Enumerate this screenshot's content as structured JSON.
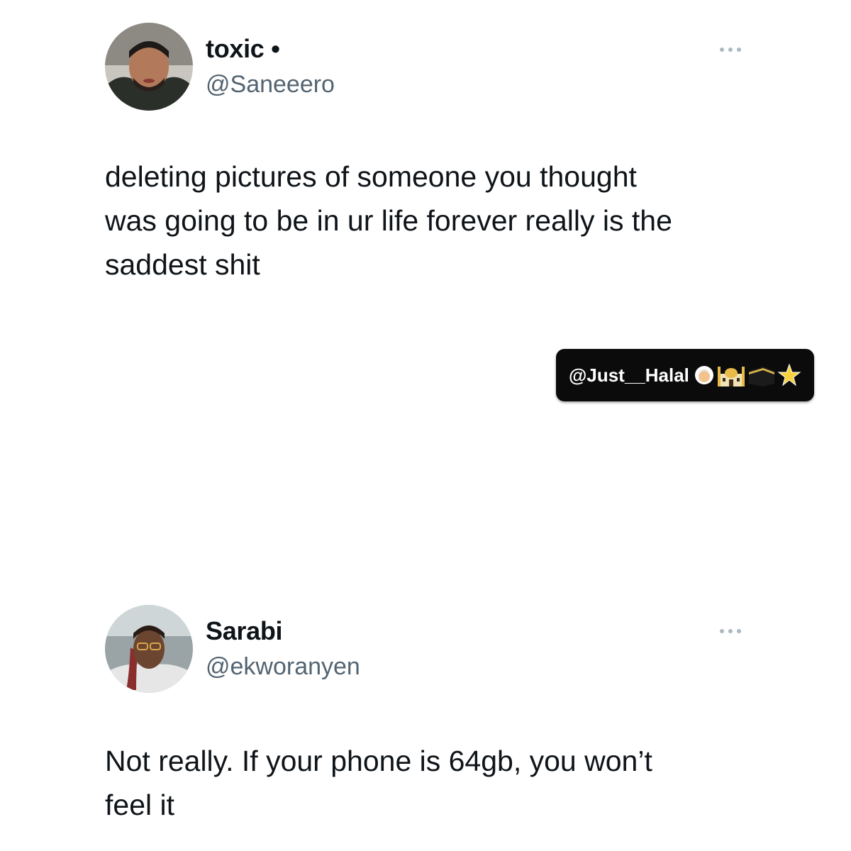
{
  "tweets": [
    {
      "name": "toxic •",
      "handle": "@Saneeero",
      "text": "deleting pictures of someone you thought\nwas going to be in ur life forever really is the\nsaddest shit",
      "more_icon": "more-horizontal-icon",
      "avatar_alt": "profile photo of toxic"
    },
    {
      "name": "Sarabi",
      "handle": "@ekworanyen",
      "text": "Not really. If your phone is 64gb, you won’t\nfeel it",
      "more_icon": "more-horizontal-icon",
      "avatar_alt": "profile photo of Sarabi"
    }
  ],
  "watermark": {
    "text": "@Just__Halal",
    "icons": [
      "person-emoji-icon",
      "mosque-emoji-icon",
      "kaaba-emoji-icon",
      "sparkle-star-icon"
    ]
  },
  "colors": {
    "name": "#0f1419",
    "handle": "#536471",
    "more_dots": "#aab8c2",
    "watermark_bg": "#0b0b0b",
    "watermark_text": "#ffffff"
  }
}
